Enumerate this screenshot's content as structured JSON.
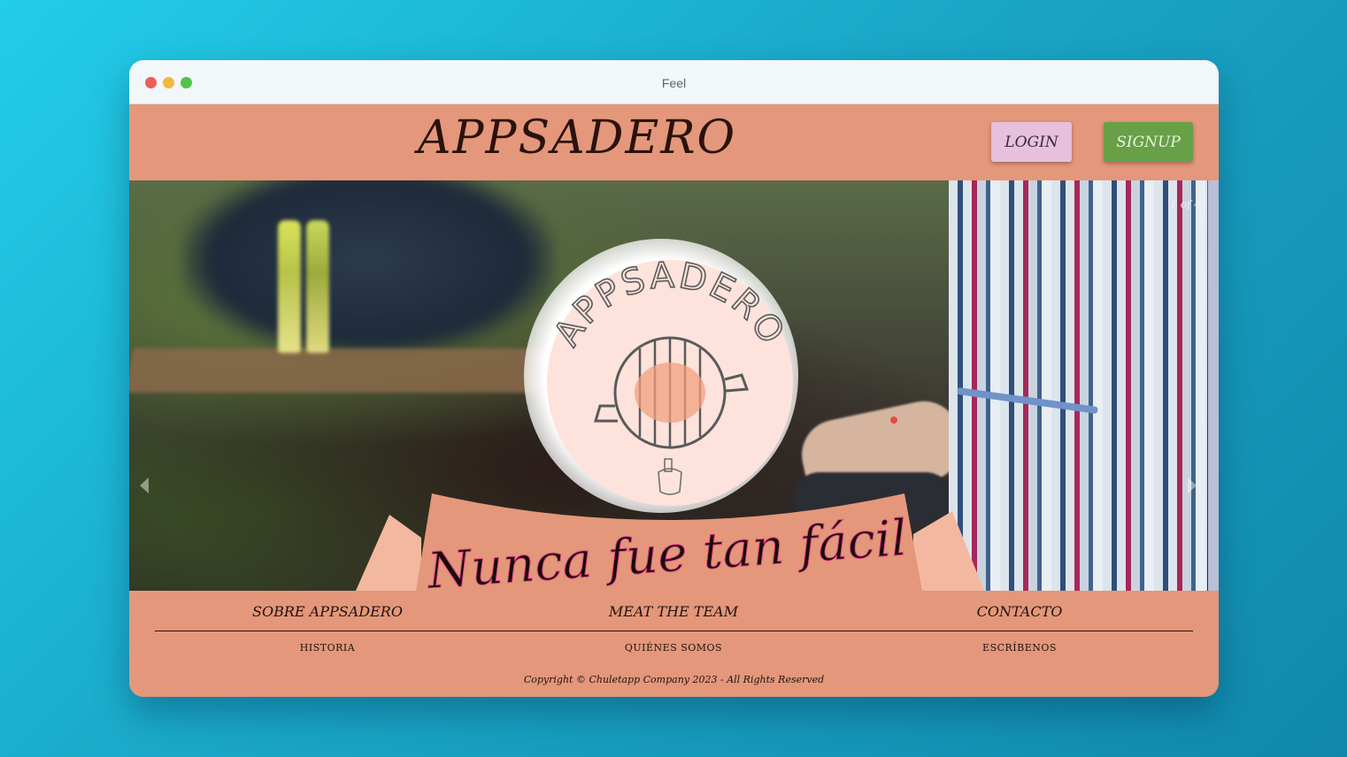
{
  "window": {
    "title": "Feel"
  },
  "header": {
    "brand": "APPSADERO",
    "login_label": "LOGIN",
    "signup_label": "SIGNUP"
  },
  "hero": {
    "counter": "1 of 4",
    "logo_text": "APPSADERO",
    "tagline": "Nunca fue tan fácil"
  },
  "footer": {
    "columns": [
      {
        "title": "SOBRE APPSADERO",
        "link": "HISTORIA"
      },
      {
        "title": "MEAT THE TEAM",
        "link": "QUIÉNES SOMOS"
      },
      {
        "title": "CONTACTO",
        "link": "ESCRÍBENOS"
      }
    ],
    "copyright": "Copyright © Chuletapp Company 2023 - All Rights Reserved"
  },
  "colors": {
    "background": "#1aa7c8",
    "header": "#e4977a",
    "login_button": "#e6c0dd",
    "signup_button": "#67a047",
    "logo_circle": "#fde3dc"
  }
}
